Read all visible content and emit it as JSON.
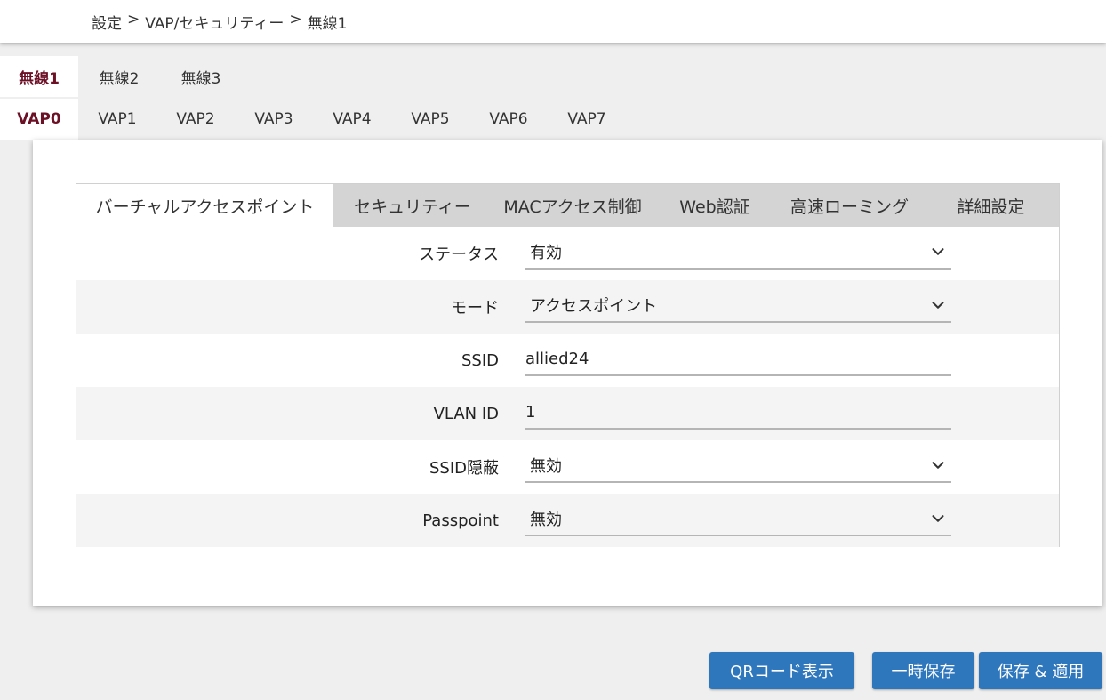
{
  "breadcrumb": {
    "items": [
      "設定",
      "VAP/セキュリティー",
      "無線1"
    ],
    "separator": ">"
  },
  "radio_tabs": [
    "無線1",
    "無線2",
    "無線3"
  ],
  "vap_tabs": [
    "VAP0",
    "VAP1",
    "VAP2",
    "VAP3",
    "VAP4",
    "VAP5",
    "VAP6",
    "VAP7"
  ],
  "sub_tabs": [
    "バーチャルアクセスポイント",
    "セキュリティー",
    "MACアクセス制御",
    "Web認証",
    "高速ローミング",
    "詳細設定"
  ],
  "form": {
    "status": {
      "label": "ステータス",
      "value": "有効"
    },
    "mode": {
      "label": "モード",
      "value": "アクセスポイント"
    },
    "ssid": {
      "label": "SSID",
      "value": "allied24"
    },
    "vlan": {
      "label": "VLAN ID",
      "value": "1"
    },
    "ssid_hide": {
      "label": "SSID隠蔽",
      "value": "無効"
    },
    "passpoint": {
      "label": "Passpoint",
      "value": "無効"
    }
  },
  "buttons": {
    "qr": "QRコード表示",
    "temp_save": "一時保存",
    "save_apply": "保存 & 適用"
  },
  "colors": {
    "accent": "#6b1025",
    "button": "#2f77bd"
  }
}
